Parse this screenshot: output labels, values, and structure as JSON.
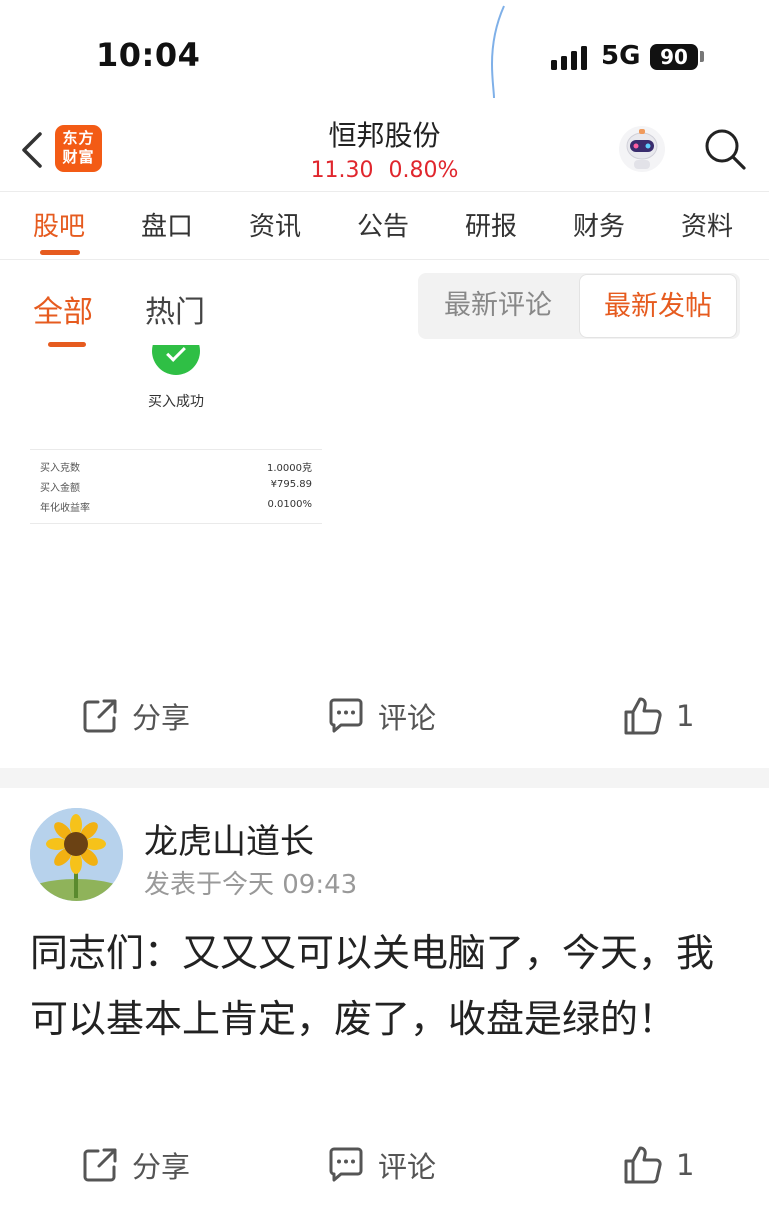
{
  "status_bar": {
    "time": "10:04",
    "network": "5G",
    "battery": "90"
  },
  "header": {
    "logo_line1": "东方",
    "logo_line2": "财富",
    "stock_name": "恒邦股份",
    "price": "11.30",
    "change_pct": "0.80%",
    "quote_color": "#e0262d"
  },
  "tabs": [
    "股吧",
    "盘口",
    "资讯",
    "公告",
    "研报",
    "财务",
    "资料"
  ],
  "active_tab": "股吧",
  "sub_tabs": {
    "all": "全部",
    "hot": "热门"
  },
  "sort": {
    "latest_comment": "最新评论",
    "latest_post": "最新发帖"
  },
  "accent_color": "#e65b1f",
  "receipt": {
    "title": "买入成功",
    "rows": [
      {
        "label": "买入克数",
        "value": "1.0000克"
      },
      {
        "label": "买入金额",
        "value": "¥795.89"
      },
      {
        "label": "年化收益率",
        "value": "0.0100%"
      }
    ]
  },
  "post1_actions": {
    "share": "分享",
    "comment": "评论",
    "likes": "1"
  },
  "post2": {
    "author": "龙虎山道长",
    "time": "发表于今天 09:43",
    "body": "同志们：又又又可以关电脑了，今天，我可以基本上肯定，废了，收盘是绿的！",
    "actions": {
      "share": "分享",
      "comment": "评论",
      "likes": "1"
    }
  },
  "icons": [
    "back-icon",
    "search-icon",
    "robot-avatar-icon",
    "share-icon",
    "comment-icon",
    "like-icon",
    "check-icon"
  ]
}
